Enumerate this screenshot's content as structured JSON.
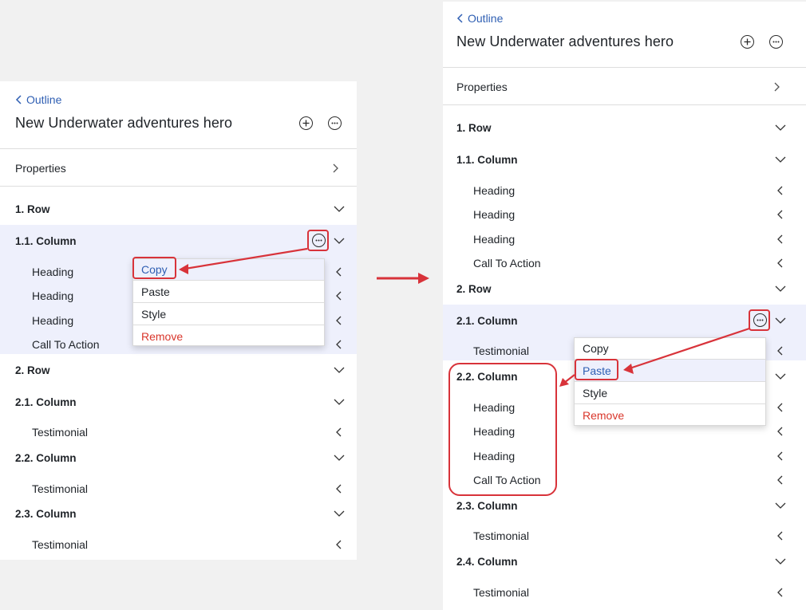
{
  "colors": {
    "accent": "#2f5fb3",
    "highlight": "#eef0fc",
    "danger": "#d9362b",
    "annotation": "#d8333a"
  },
  "left": {
    "back_label": "Outline",
    "title": "New Underwater adventures hero",
    "properties_label": "Properties",
    "outline": {
      "row1": "1. Row",
      "col11": "1.1. Column",
      "col11_items": [
        "Heading",
        "Heading",
        "Heading",
        "Call To Action"
      ],
      "row2": "2. Row",
      "col21": "2.1. Column",
      "col21_item": "Testimonial",
      "col22": "2.2. Column",
      "col22_item": "Testimonial",
      "col23": "2.3. Column",
      "col23_item": "Testimonial"
    },
    "menu": {
      "copy": "Copy",
      "paste": "Paste",
      "style": "Style",
      "remove": "Remove"
    }
  },
  "right": {
    "back_label": "Outline",
    "title": "New Underwater adventures hero",
    "properties_label": "Properties",
    "outline": {
      "row1": "1. Row",
      "col11": "1.1. Column",
      "col11_items": [
        "Heading",
        "Heading",
        "Heading",
        "Call To Action"
      ],
      "row2": "2. Row",
      "col21": "2.1. Column",
      "col21_item": "Testimonial",
      "col22": "2.2. Column",
      "col22_items": [
        "Heading",
        "Heading",
        "Heading",
        "Call To Action"
      ],
      "col23": "2.3. Column",
      "col23_item": "Testimonial",
      "col24": "2.4. Column",
      "col24_item": "Testimonial"
    },
    "menu": {
      "copy": "Copy",
      "paste": "Paste",
      "style": "Style",
      "remove": "Remove"
    }
  },
  "icons": [
    "chevron-left-icon",
    "plus-circle-icon",
    "more-circle-icon",
    "chevron-right-icon",
    "chevron-down-icon",
    "arrow-right-icon"
  ]
}
